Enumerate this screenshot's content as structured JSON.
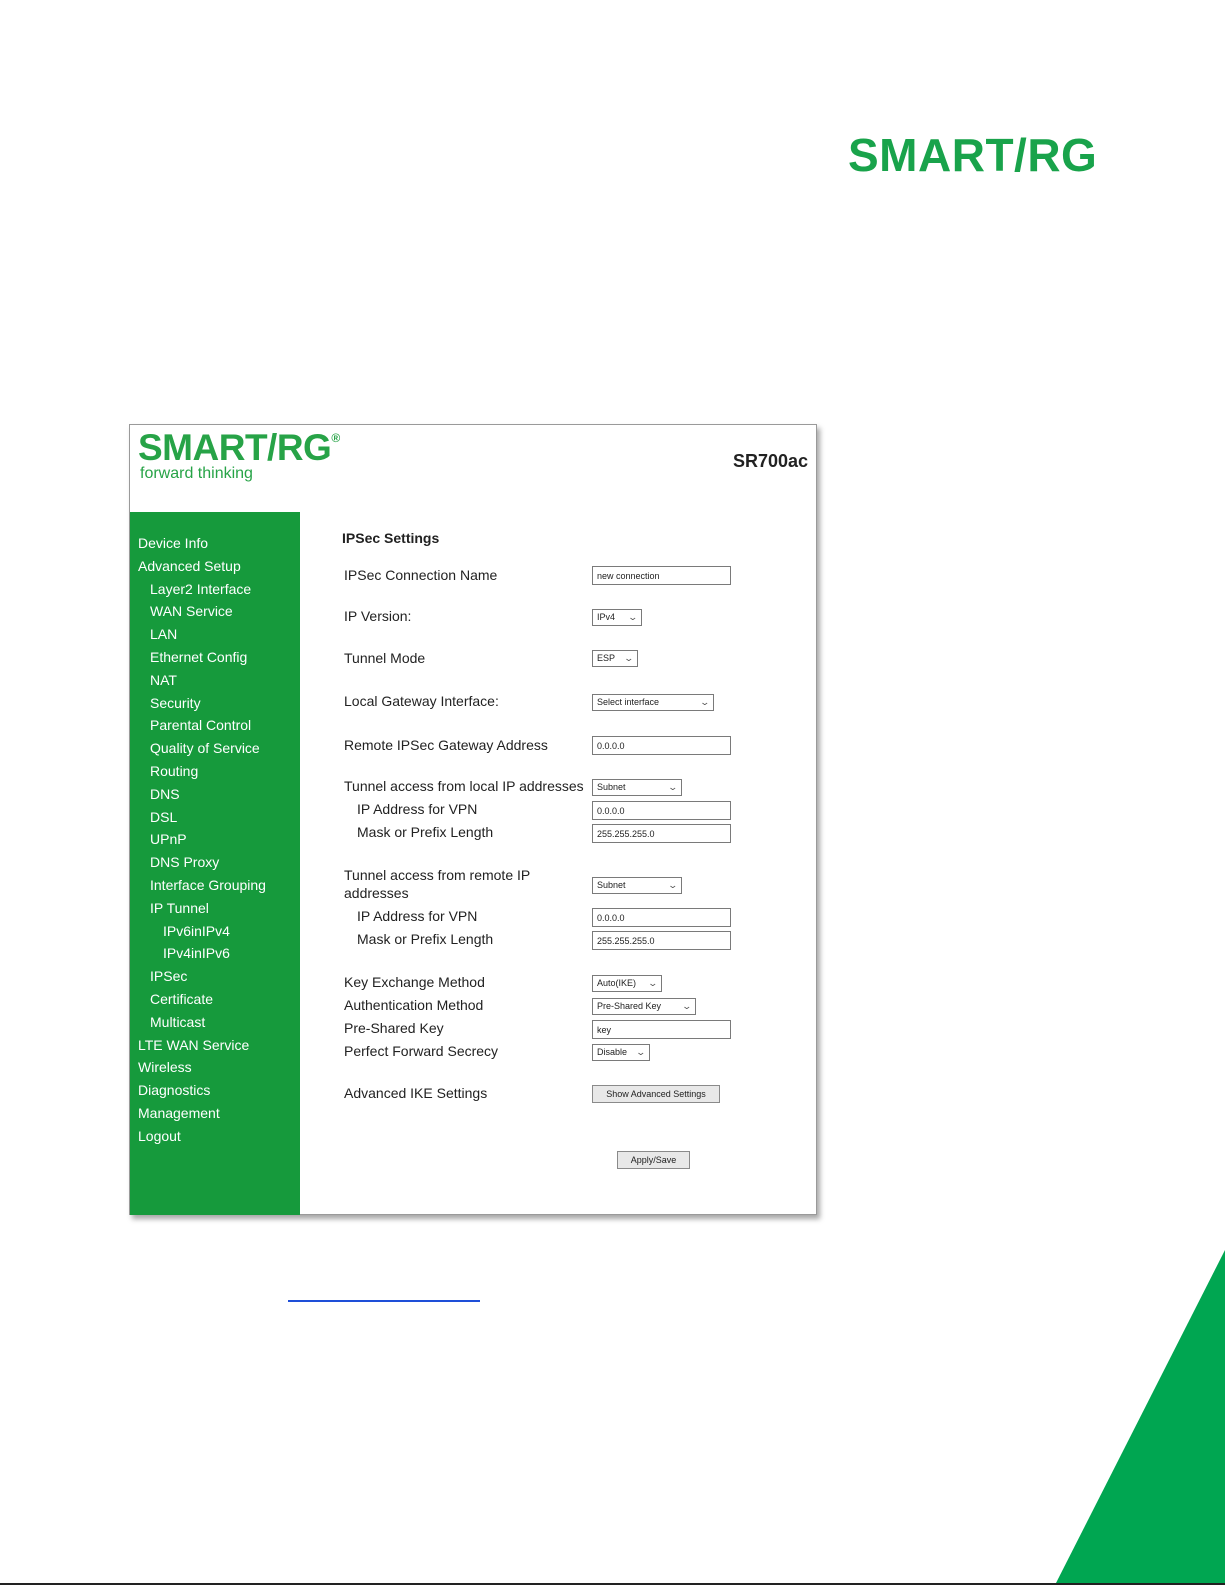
{
  "brand": {
    "logo": "SMART/RG"
  },
  "router": {
    "logo": "SMART/RG",
    "trademark": "®",
    "tagline": "forward thinking",
    "model": "SR700ac"
  },
  "sidebar": {
    "items": [
      {
        "label": "Device Info",
        "level": 0
      },
      {
        "label": "Advanced Setup",
        "level": 0
      },
      {
        "label": "Layer2 Interface",
        "level": 1
      },
      {
        "label": "WAN Service",
        "level": 1
      },
      {
        "label": "LAN",
        "level": 1
      },
      {
        "label": "Ethernet Config",
        "level": 1
      },
      {
        "label": "NAT",
        "level": 1
      },
      {
        "label": "Security",
        "level": 1
      },
      {
        "label": "Parental Control",
        "level": 1
      },
      {
        "label": "Quality of Service",
        "level": 1
      },
      {
        "label": "Routing",
        "level": 1
      },
      {
        "label": "DNS",
        "level": 1
      },
      {
        "label": "DSL",
        "level": 1
      },
      {
        "label": "UPnP",
        "level": 1
      },
      {
        "label": "DNS Proxy",
        "level": 1
      },
      {
        "label": "Interface Grouping",
        "level": 1
      },
      {
        "label": "IP Tunnel",
        "level": 1
      },
      {
        "label": "IPv6inIPv4",
        "level": 2
      },
      {
        "label": "IPv4inIPv6",
        "level": 2
      },
      {
        "label": "IPSec",
        "level": 1
      },
      {
        "label": "Certificate",
        "level": 1
      },
      {
        "label": "Multicast",
        "level": 1
      },
      {
        "label": "LTE WAN Service",
        "level": 0
      },
      {
        "label": "Wireless",
        "level": 0
      },
      {
        "label": "Diagnostics",
        "level": 0
      },
      {
        "label": "Management",
        "level": 0
      },
      {
        "label": "Logout",
        "level": 0
      }
    ]
  },
  "form": {
    "title": "IPSec Settings",
    "connection_name": {
      "label": "IPSec Connection Name",
      "value": "new connection"
    },
    "ip_version": {
      "label": "IP Version:",
      "value": "IPv4"
    },
    "tunnel_mode": {
      "label": "Tunnel Mode",
      "value": "ESP"
    },
    "local_gateway_interface": {
      "label": "Local Gateway Interface:",
      "value": "Select interface"
    },
    "remote_gateway": {
      "label": "Remote IPSec Gateway Address",
      "value": "0.0.0.0"
    },
    "local_access": {
      "label": "Tunnel access from local IP addresses",
      "value": "Subnet",
      "ip_label": "IP Address for VPN",
      "ip_value": "0.0.0.0",
      "mask_label": "Mask or Prefix Length",
      "mask_value": "255.255.255.0"
    },
    "remote_access": {
      "label_line1": "Tunnel access from remote IP",
      "label_line2": "addresses",
      "value": "Subnet",
      "ip_label": "IP Address for VPN",
      "ip_value": "0.0.0.0",
      "mask_label": "Mask or Prefix Length",
      "mask_value": "255.255.255.0"
    },
    "key_exchange": {
      "label": "Key Exchange Method",
      "value": "Auto(IKE)"
    },
    "auth_method": {
      "label": "Authentication Method",
      "value": "Pre-Shared Key"
    },
    "pre_shared_key": {
      "label": "Pre-Shared Key",
      "value": "key"
    },
    "pfs": {
      "label": "Perfect Forward Secrecy",
      "value": "Disable"
    },
    "advanced_ike": {
      "label": "Advanced IKE Settings",
      "button": "Show Advanced Settings"
    },
    "apply_button": "Apply/Save"
  },
  "colors": {
    "brand_green": "#19a34b",
    "sidebar_green": "#169a3c",
    "corner_green": "#00a651",
    "link_blue": "#1e4fd8"
  }
}
